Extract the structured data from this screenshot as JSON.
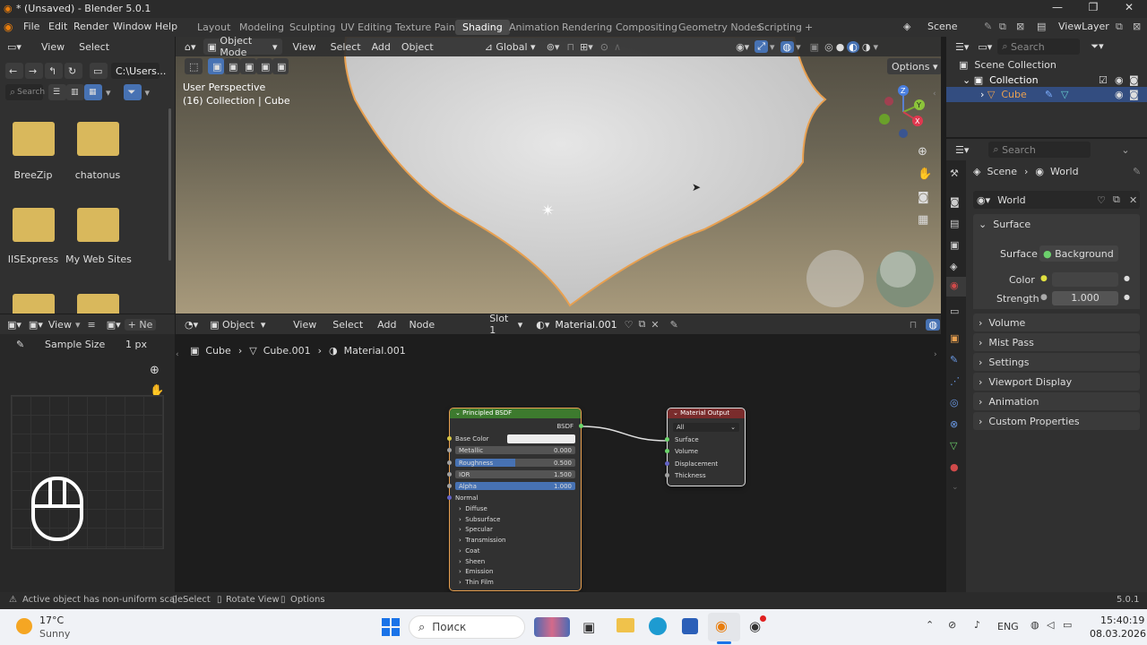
{
  "window": {
    "title": "* (Unsaved) - Blender 5.0.1",
    "controls": [
      "—",
      "❐",
      "✕"
    ]
  },
  "menu": [
    "File",
    "Edit",
    "Render",
    "Window",
    "Help"
  ],
  "workspaces": [
    "Layout",
    "Modeling",
    "Sculpting",
    "UV Editing",
    "Texture Paint",
    "Shading",
    "Animation",
    "Rendering",
    "Compositing",
    "Geometry Nodes",
    "Scripting",
    "+"
  ],
  "active_workspace": "Shading",
  "scene": {
    "name": "Scene",
    "view_layer": "ViewLayer"
  },
  "file_browser": {
    "header": {
      "view": "View",
      "select": "Select"
    },
    "path": "C:\\Users...",
    "search_placeholder": "Search",
    "folders": [
      "BreeZip",
      "chatonus",
      "IISExpress",
      "My Web Sites"
    ]
  },
  "image_editor": {
    "view": "View",
    "new_label": "Ne",
    "sample_size_label": "Sample Size",
    "sample_size_value": "1 px"
  },
  "viewport": {
    "mode": "Object Mode",
    "menus": [
      "View",
      "Select",
      "Add",
      "Object"
    ],
    "transform": "Global",
    "options": "Options",
    "perspective": "User Perspective",
    "collection_info": "(16) Collection | Cube"
  },
  "node_editor": {
    "object": "Object",
    "menus": [
      "View",
      "Select",
      "Add",
      "Node"
    ],
    "slot": "Slot 1",
    "material": "Material.001",
    "breadcrumb": [
      "Cube",
      "Cube.001",
      "Material.001"
    ],
    "bsdf": {
      "title": "Principled BSDF",
      "output": "BSDF",
      "base_color": "Base Color",
      "sliders": [
        {
          "label": "Metallic",
          "value": "0.000",
          "fill": 0
        },
        {
          "label": "Roughness",
          "value": "0.500",
          "fill": 0.5
        },
        {
          "label": "IOR",
          "value": "1.500",
          "fill": 0
        },
        {
          "label": "Alpha",
          "value": "1.000",
          "fill": 1
        }
      ],
      "normal": "Normal",
      "panels": [
        "Diffuse",
        "Subsurface",
        "Specular",
        "Transmission",
        "Coat",
        "Sheen",
        "Emission",
        "Thin Film"
      ]
    },
    "output": {
      "title": "Material Output",
      "target": "All",
      "inputs": [
        "Surface",
        "Volume",
        "Displacement",
        "Thickness"
      ]
    }
  },
  "outliner": {
    "search_placeholder": "Search",
    "items": [
      {
        "label": "Scene Collection",
        "level": 0
      },
      {
        "label": "Collection",
        "level": 1
      },
      {
        "label": "Cube",
        "level": 2
      }
    ]
  },
  "properties": {
    "search_placeholder": "Search",
    "breadcrumb": [
      "Scene",
      "World"
    ],
    "world_name": "World",
    "surface_panel": "Surface",
    "surface_label": "Surface",
    "surface_value": "Background",
    "color_label": "Color",
    "strength_label": "Strength",
    "strength_value": "1.000",
    "collapsed_panels": [
      "Volume",
      "Mist Pass",
      "Settings",
      "Viewport Display",
      "Animation",
      "Custom Properties"
    ]
  },
  "status": {
    "message": "Active object has non-uniform scale",
    "hints": [
      "Select",
      "Rotate View",
      "Options"
    ],
    "version": "5.0.1"
  },
  "taskbar": {
    "weather_temp": "17°C",
    "weather_desc": "Sunny",
    "search": "Поиск",
    "lang": "ENG",
    "time": "15:40:19",
    "date": "08.03.2026"
  },
  "colors": {
    "accent": "#4772b3",
    "shader_header": "#3d7a2e",
    "output_header": "#7a2c2c",
    "selection_outline": "#e8a050"
  }
}
